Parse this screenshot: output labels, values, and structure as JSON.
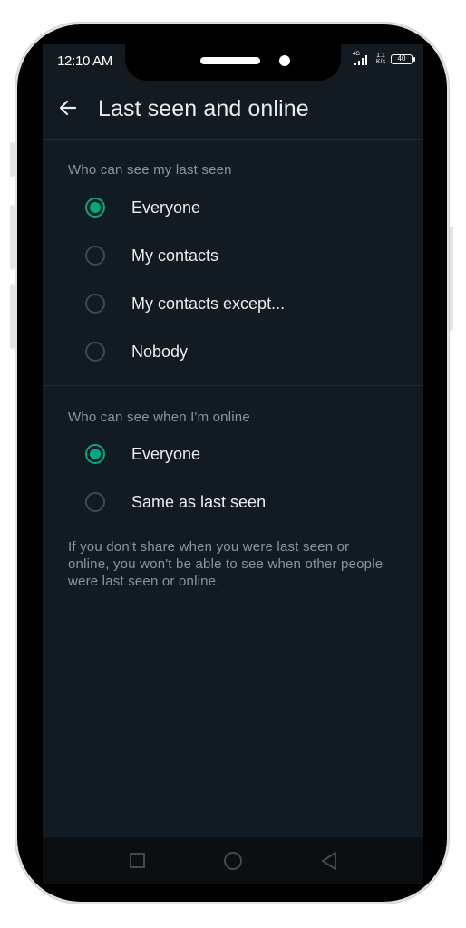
{
  "status": {
    "time": "12:10 AM",
    "network": "4G",
    "speed_value": "1.1",
    "speed_unit": "K/s",
    "battery": "40"
  },
  "header": {
    "back_icon": "arrow-left-icon",
    "title": "Last seen and online"
  },
  "last_seen": {
    "title": "Who can see my last seen",
    "options": [
      {
        "label": "Everyone",
        "selected": true
      },
      {
        "label": "My contacts",
        "selected": false
      },
      {
        "label": "My contacts except...",
        "selected": false
      },
      {
        "label": "Nobody",
        "selected": false
      }
    ]
  },
  "online": {
    "title": "Who can see when I'm online",
    "options": [
      {
        "label": "Everyone",
        "selected": true
      },
      {
        "label": "Same as last seen",
        "selected": false
      }
    ]
  },
  "note": "If you don't share when you were last seen or online, you won't be able to see when other people were last seen or online.",
  "colors": {
    "background": "#121b22",
    "accent": "#00a884",
    "primary_text": "#e9edef",
    "secondary_text": "#8696a0"
  },
  "navbar": {
    "recents_icon": "square-icon",
    "home_icon": "circle-icon",
    "back_icon": "triangle-back-icon"
  }
}
